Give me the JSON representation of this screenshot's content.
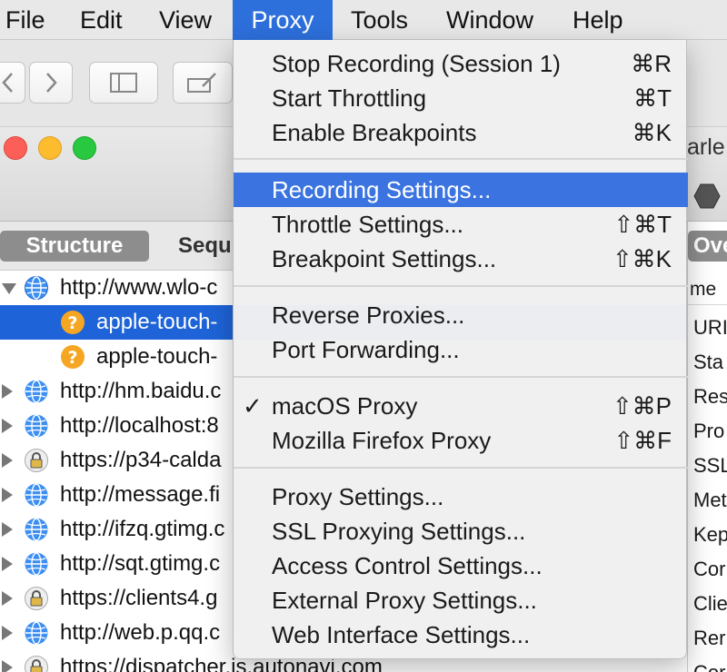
{
  "menubar": {
    "items": [
      {
        "label": "File"
      },
      {
        "label": "Edit"
      },
      {
        "label": "View"
      },
      {
        "label": "Proxy",
        "active": true
      },
      {
        "label": "Tools"
      },
      {
        "label": "Window"
      },
      {
        "label": "Help"
      }
    ]
  },
  "window": {
    "title_partial": "arle",
    "tabs": {
      "structure": "Structure",
      "sequence_partial": "Sequ"
    },
    "overview_partial": "Ove",
    "right_header_partial": "me",
    "right_rows": [
      "URI",
      "Sta",
      "Res",
      "Pro",
      "SSL",
      "Met",
      "Kep",
      "Cor",
      "Clie",
      "Rer",
      "Cor"
    ]
  },
  "tree": {
    "rows": [
      {
        "text": "http://www.wlo-c",
        "icon": "globe-icon",
        "expander": "down"
      },
      {
        "text": "apple-touch-",
        "icon": "question-icon",
        "selected": true
      },
      {
        "text": "apple-touch-",
        "icon": "question-icon"
      },
      {
        "text": "http://hm.baidu.c",
        "icon": "globe-icon",
        "expander": "right"
      },
      {
        "text": "http://localhost:8",
        "icon": "globe-icon",
        "expander": "right"
      },
      {
        "text": "https://p34-calda",
        "icon": "lock-icon",
        "expander": "right"
      },
      {
        "text": "http://message.fi",
        "icon": "globe-icon",
        "expander": "right"
      },
      {
        "text": "http://ifzq.gtimg.c",
        "icon": "globe-icon",
        "expander": "right"
      },
      {
        "text": "http://sqt.gtimg.c",
        "icon": "globe-icon",
        "expander": "right"
      },
      {
        "text": "https://clients4.g",
        "icon": "lock-icon",
        "expander": "right"
      },
      {
        "text": "http://web.p.qq.c",
        "icon": "globe-icon",
        "expander": "right"
      },
      {
        "text": "https://dispatcher.is.autonavi.com",
        "icon": "lock-icon",
        "expander": "right"
      }
    ]
  },
  "proxy_menu": {
    "groups": [
      [
        {
          "label": "Stop Recording (Session 1)",
          "shortcut": "⌘R"
        },
        {
          "label": "Start Throttling",
          "shortcut": "⌘T"
        },
        {
          "label": "Enable Breakpoints",
          "shortcut": "⌘K"
        }
      ],
      [
        {
          "label": "Recording Settings...",
          "shortcut": "",
          "highlighted": true
        },
        {
          "label": "Throttle Settings...",
          "shortcut": "⇧⌘T"
        },
        {
          "label": "Breakpoint Settings...",
          "shortcut": "⇧⌘K"
        }
      ],
      [
        {
          "label": "Reverse Proxies...",
          "shortcut": ""
        },
        {
          "label": "Port Forwarding...",
          "shortcut": ""
        }
      ],
      [
        {
          "label": "macOS Proxy",
          "shortcut": "⇧⌘P",
          "checked": true
        },
        {
          "label": "Mozilla Firefox Proxy",
          "shortcut": "⇧⌘F"
        }
      ],
      [
        {
          "label": "Proxy Settings...",
          "shortcut": ""
        },
        {
          "label": "SSL Proxying Settings...",
          "shortcut": ""
        },
        {
          "label": "Access Control Settings...",
          "shortcut": ""
        },
        {
          "label": "External Proxy Settings...",
          "shortcut": ""
        },
        {
          "label": "Web Interface Settings...",
          "shortcut": ""
        }
      ]
    ],
    "check_mark": "✓"
  },
  "colors": {
    "menu_highlight": "#3b74e0",
    "selection": "#1e64d8",
    "traffic_red": "#fc5f57",
    "traffic_yellow": "#fdbc2e",
    "traffic_green": "#28c840"
  }
}
